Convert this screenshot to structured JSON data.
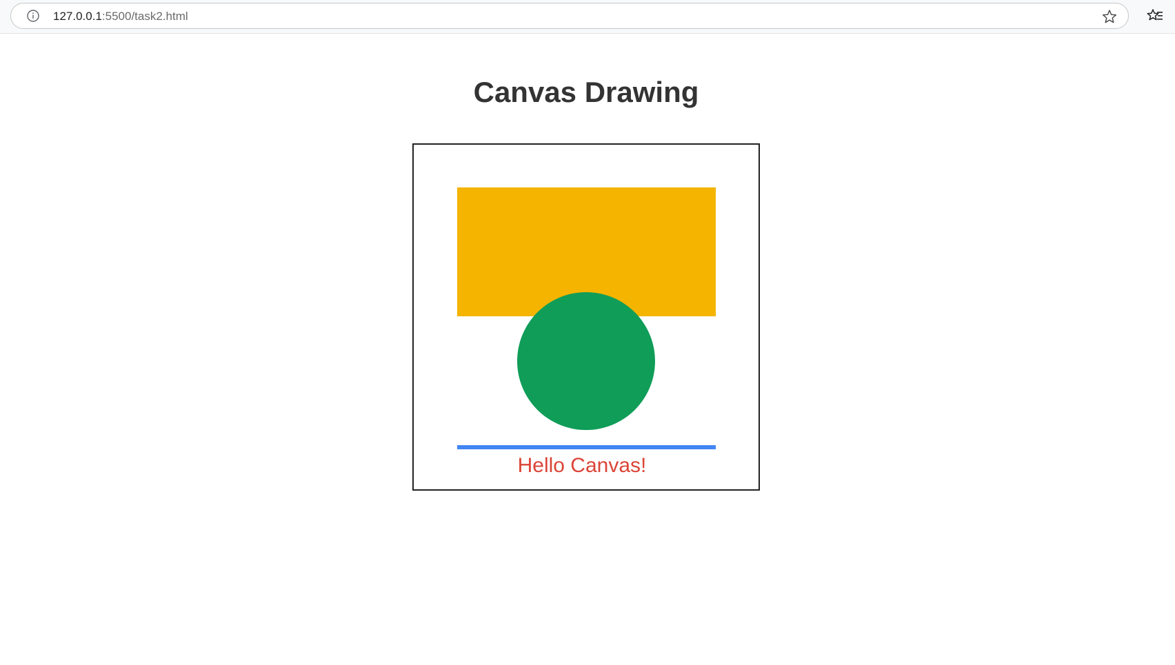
{
  "browser": {
    "url_host": "127.0.0.1",
    "url_rest": ":5500/task2.html",
    "icons": {
      "info": "info-icon",
      "star": "star-icon",
      "favorites": "favorites-icon"
    }
  },
  "page": {
    "title": "Canvas Drawing"
  },
  "canvas": {
    "text": "Hello Canvas!",
    "colors": {
      "rectangle": "#F4B400",
      "circle": "#0F9D58",
      "line": "#4285F4",
      "text": "#DB4437",
      "border": "#222222"
    }
  }
}
